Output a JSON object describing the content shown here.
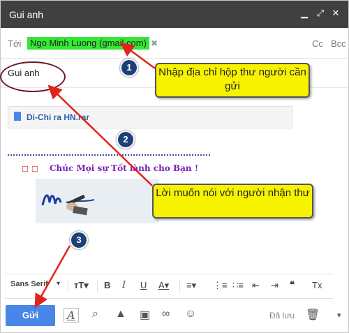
{
  "window": {
    "title": "Gui anh"
  },
  "recipients": {
    "to_label": "Tới",
    "chip": "Ngo Minh Luong (gmail.com)",
    "cc": "Cc",
    "bcc": "Bcc"
  },
  "subject": "Gui anh",
  "attachment": {
    "name": "Di-Chi ra HN.rar"
  },
  "body": {
    "wish": "Chúc Mọi sự Tốt lành cho Bạn !",
    "signature": "Ngo Minh Luong signature"
  },
  "toolbar": {
    "font_label": "Sans Serif"
  },
  "actions": {
    "send_label": "Gửi",
    "saved_label": "Đã lưu"
  },
  "annotations": {
    "callout_1": "Nhập địa chỉ hộp thư người cần gửi",
    "callout_2": "Lời muốn nói với người nhận thư",
    "badge_1": "1",
    "badge_2": "2",
    "badge_3": "3"
  },
  "colors": {
    "titlebar": "#404040",
    "send": "#4a86e8",
    "chip_highlight": "#34e834",
    "callout": "#f7f200",
    "arrow": "#e2231a"
  }
}
